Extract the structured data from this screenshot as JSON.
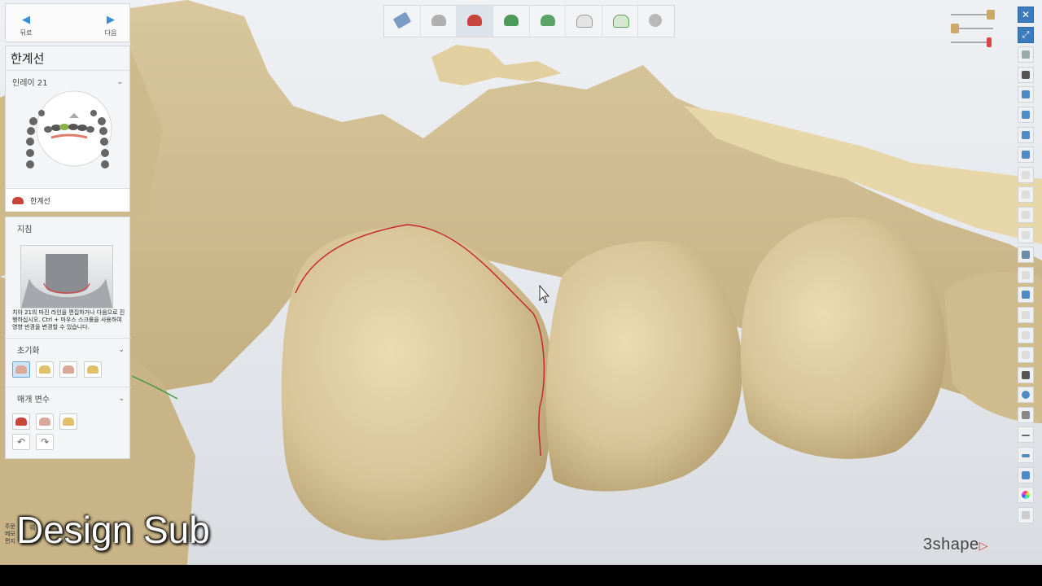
{
  "nav": {
    "back_label": "뒤로",
    "next_label": "다음"
  },
  "panel": {
    "title": "한계선",
    "tooth_select": "인레이 21",
    "current_item": "한계선"
  },
  "guide": {
    "heading": "지침",
    "text": "치아 21의 마진 라인을 편집하거나 다음으로 진행하십시오. Ctrl + 마우스 스크롤을 사용하여 영향 반경을 변경할 수 있습니다."
  },
  "sections": {
    "reset": "초기화",
    "params": "매개 변수"
  },
  "top_toolbar": {
    "steps": [
      "preparation",
      "margin-scissors",
      "margin-line",
      "insertion-direction",
      "cement-gap",
      "tooth-anatomy",
      "sculpt",
      "finish"
    ]
  },
  "overlay": {
    "caption": "Design Sub"
  },
  "brand": {
    "logo_text": "3shape",
    "logo_mark": "▷"
  },
  "footnote": {
    "lines": [
      "주문",
      "메모",
      "편지"
    ],
    "trailing": "웨"
  },
  "colors": {
    "model": "#d8c69c",
    "margin_line": "#c62a2a",
    "accent": "#3b7cc0"
  }
}
